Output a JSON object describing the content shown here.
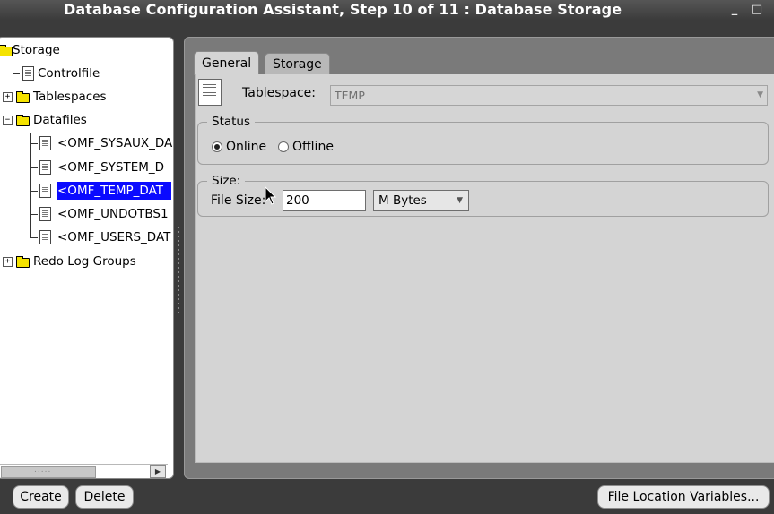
{
  "window": {
    "title": "Database Configuration Assistant, Step 10 of 11 : Database Storage"
  },
  "tree": {
    "root": "Storage",
    "items": {
      "controlfile": "Controlfile",
      "tablespaces": "Tablespaces",
      "datafiles": "Datafiles",
      "redo": "Redo Log Groups"
    },
    "datafiles": [
      "<OMF_SYSAUX_DA",
      "<OMF_SYSTEM_D",
      "<OMF_TEMP_DAT",
      "<OMF_UNDOTBS1",
      "<OMF_USERS_DAT"
    ],
    "selected": "<OMF_TEMP_DAT"
  },
  "tabs": {
    "general": "General",
    "storage": "Storage",
    "active": "General"
  },
  "general": {
    "tablespace_label": "Tablespace:",
    "tablespace_value": "TEMP",
    "status": {
      "legend": "Status",
      "online": "Online",
      "offline": "Offline",
      "selected": "Online"
    },
    "size": {
      "legend": "Size:",
      "file_size_label": "File Size:",
      "file_size_value": "200",
      "unit": "M Bytes"
    }
  },
  "buttons": {
    "create": "Create",
    "delete": "Delete",
    "file_location": "File Location Variables..."
  },
  "icons": {
    "folder": "folder-icon",
    "document": "datafile-icon",
    "minimize": "minimize-icon",
    "maximize": "maximize-icon"
  }
}
